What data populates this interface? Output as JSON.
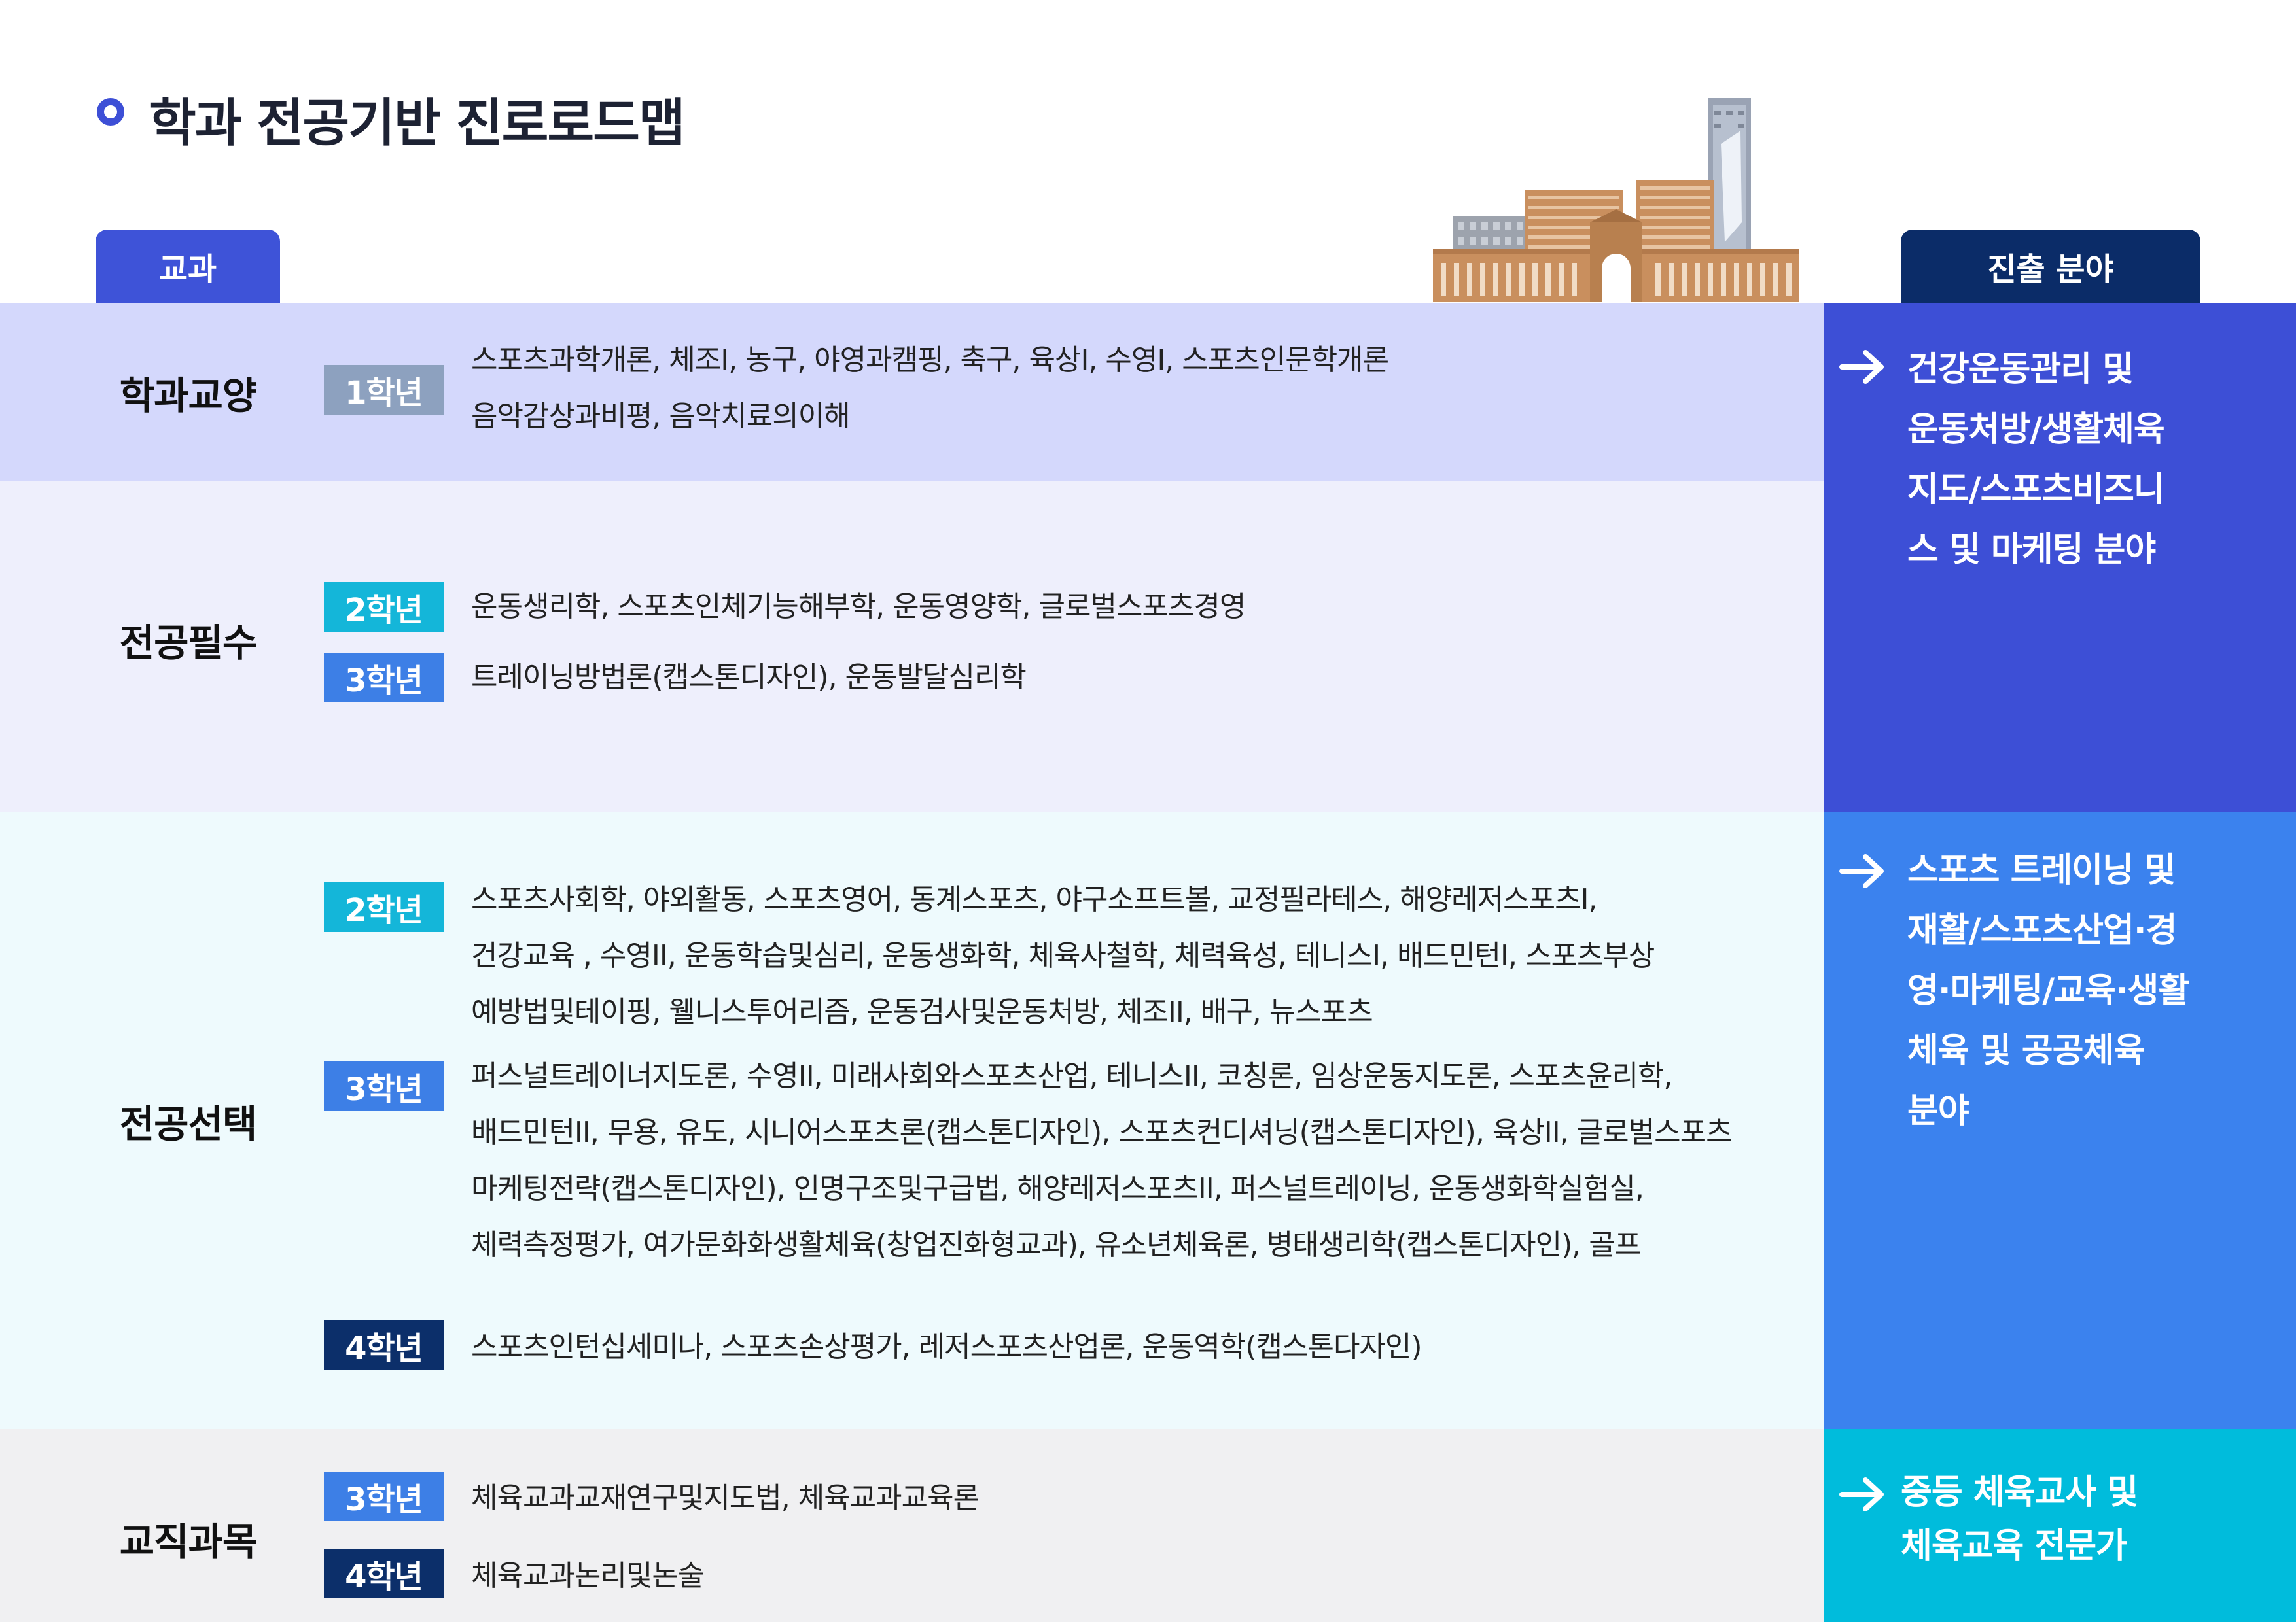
{
  "header": {
    "title": "학과 전공기반 진로로드맵",
    "subjects_tab": "교과",
    "careers_tab": "진출 분야"
  },
  "sections": [
    {
      "category": "학과교양",
      "rows": [
        {
          "grade": "1학년",
          "lines": [
            "스포츠과학개론, 체조I, 농구, 야영과캠핑, 축구, 육상I, 수영I, 스포츠인문학개론",
            "음악감상과비평, 음악치료의이해"
          ]
        }
      ]
    },
    {
      "category": "전공필수",
      "rows": [
        {
          "grade": "2학년",
          "lines": [
            "운동생리학, 스포츠인체기능해부학, 운동영양학,  글로벌스포츠경영"
          ]
        },
        {
          "grade": "3학년",
          "lines": [
            "트레이닝방법론(캡스톤디자인), 운동발달심리학"
          ]
        }
      ]
    },
    {
      "category": "전공선택",
      "rows": [
        {
          "grade": "2학년",
          "lines": [
            "스포츠사회학, 야외활동, 스포츠영어, 동계스포츠, 야구소프트볼, 교정필라테스, 해양레저스포츠I,",
            "건강교육 , 수영II, 운동학습및심리, 운동생화학, 체육사철학, 체력육성, 테니스I, 배드민턴I, 스포츠부상",
            "예방법및테이핑, 웰니스투어리즘, 운동검사및운동처방, 체조II, 배구, 뉴스포츠"
          ]
        },
        {
          "grade": "3학년",
          "lines": [
            "퍼스널트레이너지도론, 수영II, 미래사회와스포츠산업, 테니스II, 코칭론, 임상운동지도론, 스포츠윤리학,",
            "배드민턴II, 무용, 유도, 시니어스포츠론(캡스톤디자인), 스포츠컨디셔닝(캡스톤디자인), 육상II, 글로벌스포츠",
            "마케팅전략(캡스톤디자인), 인명구조및구급법, 해양레저스포츠II, 퍼스널트레이닝, 운동생화학실험실,",
            "체력측정평가, 여가문화화생활체육(창업진화형교과), 유소년체육론, 병태생리학(캡스톤디자인), 골프"
          ]
        },
        {
          "grade": "4학년",
          "lines": [
            "스포츠인턴십세미나, 스포츠손상평가, 레저스포츠산업론, 운동역학(캡스톤다자인)"
          ]
        }
      ]
    },
    {
      "category": "교직과목",
      "rows": [
        {
          "grade": "3학년",
          "lines": [
            "체육교과교재연구및지도법, 체육교과교육론"
          ]
        },
        {
          "grade": "4학년",
          "lines": [
            "체육교과논리및논술"
          ]
        }
      ]
    }
  ],
  "careers": [
    {
      "lines": [
        "건강운동관리 및",
        "운동처방/생활체육",
        "지도/스포츠비즈니",
        "스 및 마케팅 분야"
      ]
    },
    {
      "lines": [
        "스포츠 트레이닝 및",
        "재활/스포츠산업·경",
        "영·마케팅/교육·생활",
        "체육 및 공공체육",
        "분야"
      ]
    },
    {
      "lines": [
        "중등 체육교사 및",
        "체육교육 전문가"
      ]
    }
  ],
  "colors": {
    "accent": "#3d4fd6",
    "navy": "#0b2c68",
    "grade1": "#8da1bf",
    "grade2": "#14b6d9",
    "grade3": "#3d7fe6",
    "grade4": "#0c2f6a",
    "career_blue": "#3b82ee",
    "career_cyan": "#00bcdc"
  },
  "icons": [
    "circle-bullet-icon",
    "arrow-right-icon",
    "campus-skyline-illustration"
  ]
}
